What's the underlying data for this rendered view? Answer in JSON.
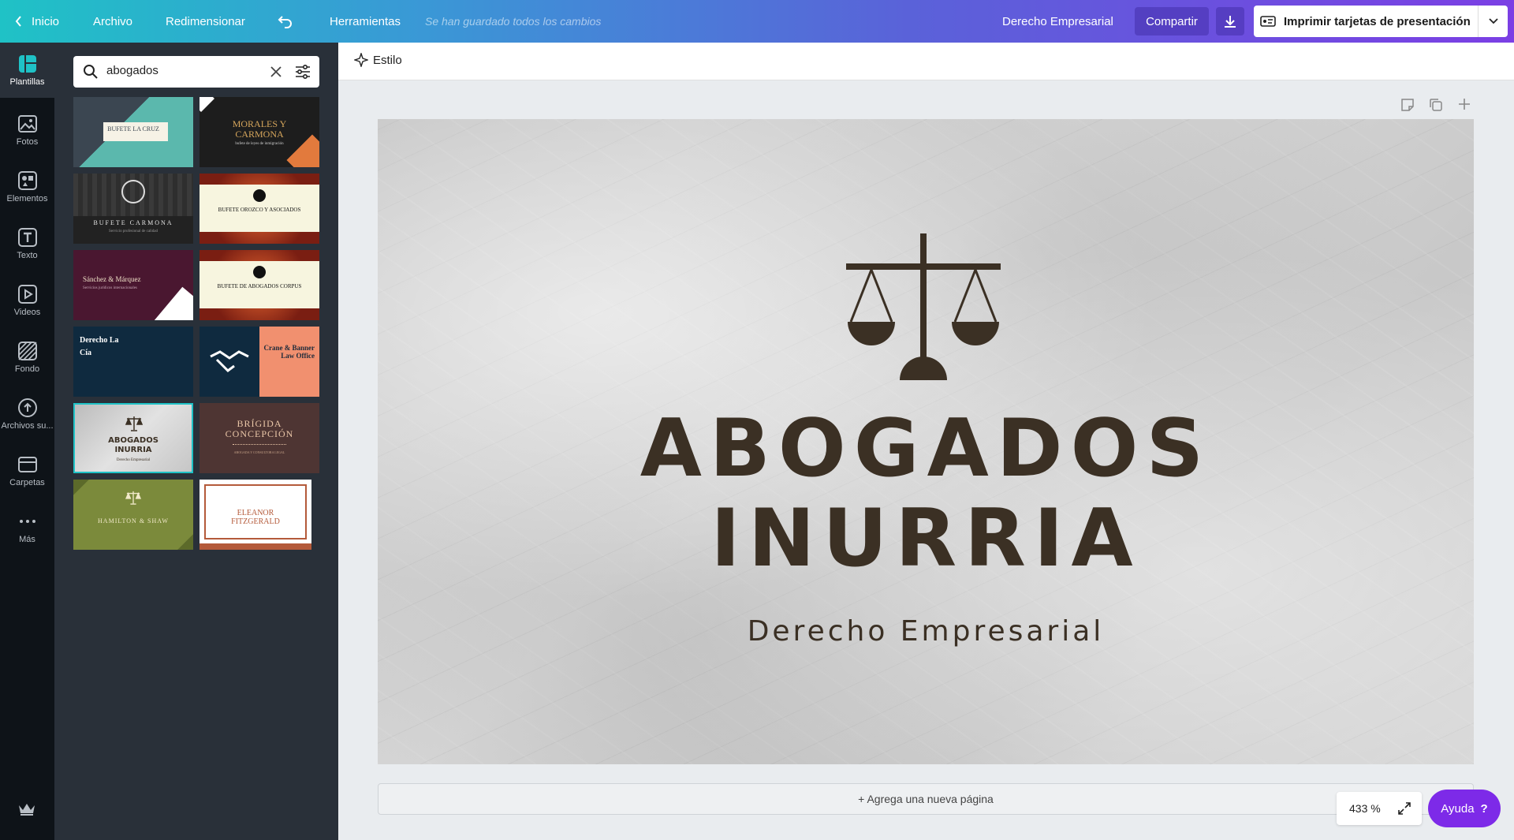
{
  "topbar": {
    "home_label": "Inicio",
    "file_label": "Archivo",
    "resize_label": "Redimensionar",
    "tools_label": "Herramientas",
    "save_status": "Se han guardado todos los cambios",
    "design_name": "Derecho Empresarial",
    "share_label": "Compartir",
    "print_label": "Imprimir tarjetas de presentación"
  },
  "sidebar": {
    "items": [
      {
        "label": "Plantillas",
        "icon": "templates-icon"
      },
      {
        "label": "Fotos",
        "icon": "photos-icon"
      },
      {
        "label": "Elementos",
        "icon": "elements-icon"
      },
      {
        "label": "Texto",
        "icon": "text-icon"
      },
      {
        "label": "Videos",
        "icon": "videos-icon"
      },
      {
        "label": "Fondo",
        "icon": "background-icon"
      },
      {
        "label": "Archivos su...",
        "icon": "uploads-icon"
      },
      {
        "label": "Carpetas",
        "icon": "folders-icon"
      },
      {
        "label": "Más",
        "icon": "more-icon"
      }
    ]
  },
  "search": {
    "value": "abogados"
  },
  "templates": [
    {
      "title": "BUFETE LA CRUZ",
      "subtitle": ""
    },
    {
      "title": "MORALES Y CARMONA",
      "subtitle": "bufete de leyes de inmigración"
    },
    {
      "title": "BUFETE CARMONA",
      "subtitle": "Servicio profesional de calidad"
    },
    {
      "title": "BUFETE OROZCO Y ASOCIADOS",
      "subtitle": ""
    },
    {
      "title": "Sánchez & Márquez",
      "subtitle": "Servicios jurídicos internacionales"
    },
    {
      "title": "BUFETE DE ABOGADOS CORPUS",
      "subtitle": ""
    },
    {
      "title": "Derecho La Cía",
      "subtitle": ""
    },
    {
      "title": "Crane & Banner Law Office",
      "subtitle": ""
    },
    {
      "title": "ABOGADOS INURRIA",
      "subtitle": "Derecho Empresarial"
    },
    {
      "title": "BRÍGIDA CONCEPCIÓN",
      "subtitle": "ABOGADA Y CONSULTORA LEGAL"
    },
    {
      "title": "HAMILTON & SHAW",
      "subtitle": ""
    },
    {
      "title": "ELEANOR FITZGERALD",
      "subtitle": ""
    }
  ],
  "stylebar": {
    "style_label": "Estilo"
  },
  "card": {
    "line1": "ABOGADOS",
    "line2": "INURRIA",
    "subtitle": "Derecho Empresarial"
  },
  "canvas": {
    "add_page_label": "+ Agrega una nueva página",
    "zoom": "433 %",
    "help_label": "Ayuda",
    "help_mark": "?"
  },
  "colors": {
    "brand_purple": "#7d2ae8",
    "card_text": "#3b3024"
  }
}
